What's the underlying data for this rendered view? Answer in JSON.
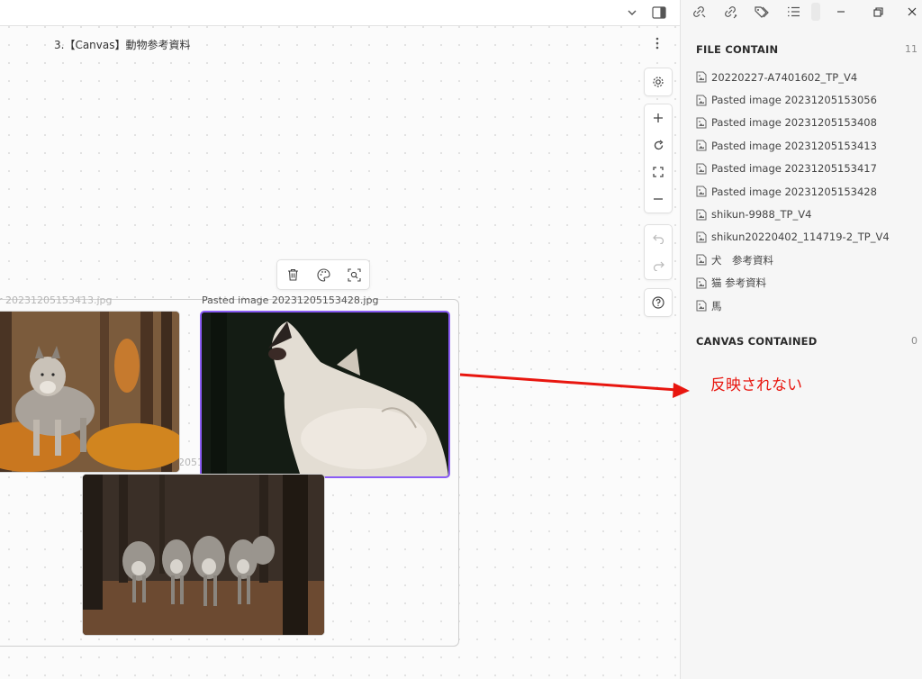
{
  "canvas": {
    "title": "3.【Canvas】動物参考資料",
    "nodes": [
      {
        "label": "r 20231205153413.jpg"
      },
      {
        "label": "Pasted image 20231205153428.jpg"
      },
      {
        "label": "2051"
      }
    ]
  },
  "sidebar": {
    "file_contain": {
      "heading": "FILE CONTAIN",
      "count": "11",
      "items": [
        {
          "label": "20220227-A7401602_TP_V4"
        },
        {
          "label": "Pasted image 20231205153056"
        },
        {
          "label": "Pasted image 20231205153408"
        },
        {
          "label": "Pasted image 20231205153413"
        },
        {
          "label": "Pasted image 20231205153417"
        },
        {
          "label": "Pasted image 20231205153428"
        },
        {
          "label": "shikun-9988_TP_V4"
        },
        {
          "label": "shikun20220402_114719-2_TP_V4"
        },
        {
          "label": "犬　参考資料"
        },
        {
          "label": "猫 参考資料"
        },
        {
          "label": "馬"
        }
      ]
    },
    "canvas_contained": {
      "heading": "CANVAS CONTAINED",
      "count": "0"
    }
  },
  "annotation": {
    "text": "反映されない",
    "color": "#e8160f"
  },
  "colors": {
    "selection": "#8a5cf5",
    "canvas_bg": "#fbfbfb",
    "sidebar_bg": "#f6f6f6"
  }
}
